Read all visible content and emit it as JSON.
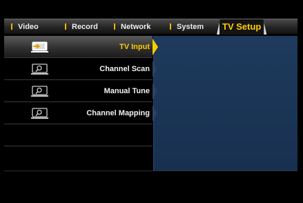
{
  "tabs": [
    {
      "label": "Video",
      "active": false
    },
    {
      "label": "Record",
      "active": false
    },
    {
      "label": "Network",
      "active": false
    },
    {
      "label": "System",
      "active": false
    },
    {
      "label": "TV Setup",
      "active": true
    }
  ],
  "menu": {
    "items": [
      {
        "label": "TV Input",
        "icon": "tv-input-icon",
        "selected": true
      },
      {
        "label": "Channel Scan",
        "icon": "search-tv-icon",
        "selected": false
      },
      {
        "label": "Manual Tune",
        "icon": "search-tv-icon",
        "selected": false
      },
      {
        "label": "Channel Mapping",
        "icon": "search-tv-icon",
        "selected": false
      }
    ]
  },
  "colors": {
    "accent": "#ffcc00",
    "panel": "#1e3a5c",
    "separator": "#e8b800"
  }
}
